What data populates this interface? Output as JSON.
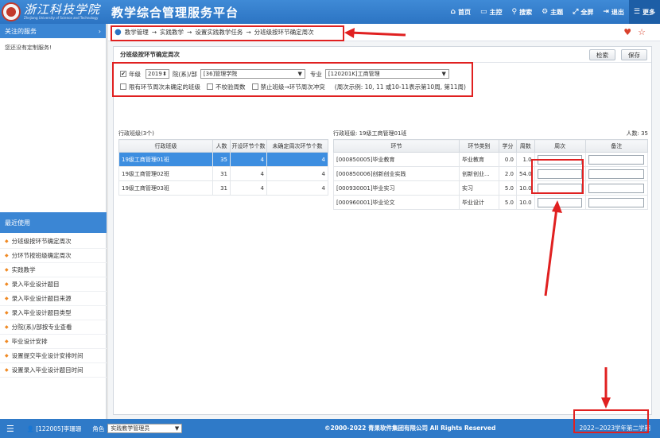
{
  "header": {
    "logo_text": "浙江科技学院",
    "logo_en": "Zhejiang University of Science and Technology",
    "title": "教学综合管理服务平台",
    "nav": [
      {
        "icon": "home-icon",
        "label": "首页"
      },
      {
        "icon": "monitor-icon",
        "label": "主控"
      },
      {
        "icon": "search-icon",
        "label": "搜索"
      },
      {
        "icon": "gears-icon",
        "label": "主题"
      },
      {
        "icon": "fullscreen-icon",
        "label": "全屏"
      },
      {
        "icon": "exit-icon",
        "label": "退出"
      },
      {
        "icon": "menu-icon",
        "label": "更多"
      }
    ]
  },
  "sidebar": {
    "fav_title": "关注的服务",
    "fav_empty": "您还没有定制服务!",
    "recent_title": "最近使用",
    "recent_items": [
      "分班级按环节确定周次",
      "分环节按班级确定周次",
      "实践教学",
      "录入毕业设计题目",
      "录入毕业设计题目来源",
      "录入毕业设计题目类型",
      "分院(系)/部按专业查看",
      "毕业设计安排",
      "设置提交毕业设计安排时间",
      "设置录入毕业设计题目时间"
    ]
  },
  "breadcrumb": [
    "教学管理",
    "实践教学",
    "设置实践教学任务",
    "分班级按环节确定周次"
  ],
  "panel": {
    "title": "分班级按环节确定周次",
    "search_btn": "检索",
    "save_btn": "保存"
  },
  "filters": {
    "year_label": "年级",
    "year_value": "2019",
    "college_label": "院(系)/部",
    "college_value": "[36]管理学院",
    "major_label": "专业",
    "major_value": "[120201K]工商管理",
    "opt1": "限有环节周次未确定的班级",
    "opt2": "不校验周数",
    "opt3": "禁止班级→环节周次冲突",
    "hint": "(周次示例: 10, 11 或10-11表示第10周, 第11周)"
  },
  "left_grid": {
    "caption": "行政班级(3个)",
    "headers": [
      "行政班级",
      "人数",
      "开设环节个数",
      "未确定周次环节个数"
    ],
    "rows": [
      [
        "19级工商管理01班",
        "35",
        "4",
        "4"
      ],
      [
        "19级工商管理02班",
        "31",
        "4",
        "4"
      ],
      [
        "19级工商管理03班",
        "31",
        "4",
        "4"
      ]
    ]
  },
  "right_grid": {
    "caption": "行政班级: 19级工商管理01班",
    "count": "人数: 35",
    "headers": [
      "环节",
      "环节类别",
      "学分",
      "周数",
      "周次",
      "备注"
    ],
    "rows": [
      [
        "[000850005]毕业教育",
        "毕业教育",
        "0.0",
        "1.0"
      ],
      [
        "[000850006]创新创业实践",
        "创新创业...",
        "2.0",
        "54.0"
      ],
      [
        "[000930001]毕业实习",
        "实习",
        "5.0",
        "10.0"
      ],
      [
        "[000960001]毕业论文",
        "毕业设计",
        "5.0",
        "10.0"
      ]
    ]
  },
  "footer": {
    "user": "[122005]李珊珊",
    "role_label": "角色",
    "role_value": "实践教学管理员",
    "copyright": "©2000-2022 青果软件集团有限公司 All Rights Reserved",
    "term": "2022~2023学年第二学期"
  }
}
